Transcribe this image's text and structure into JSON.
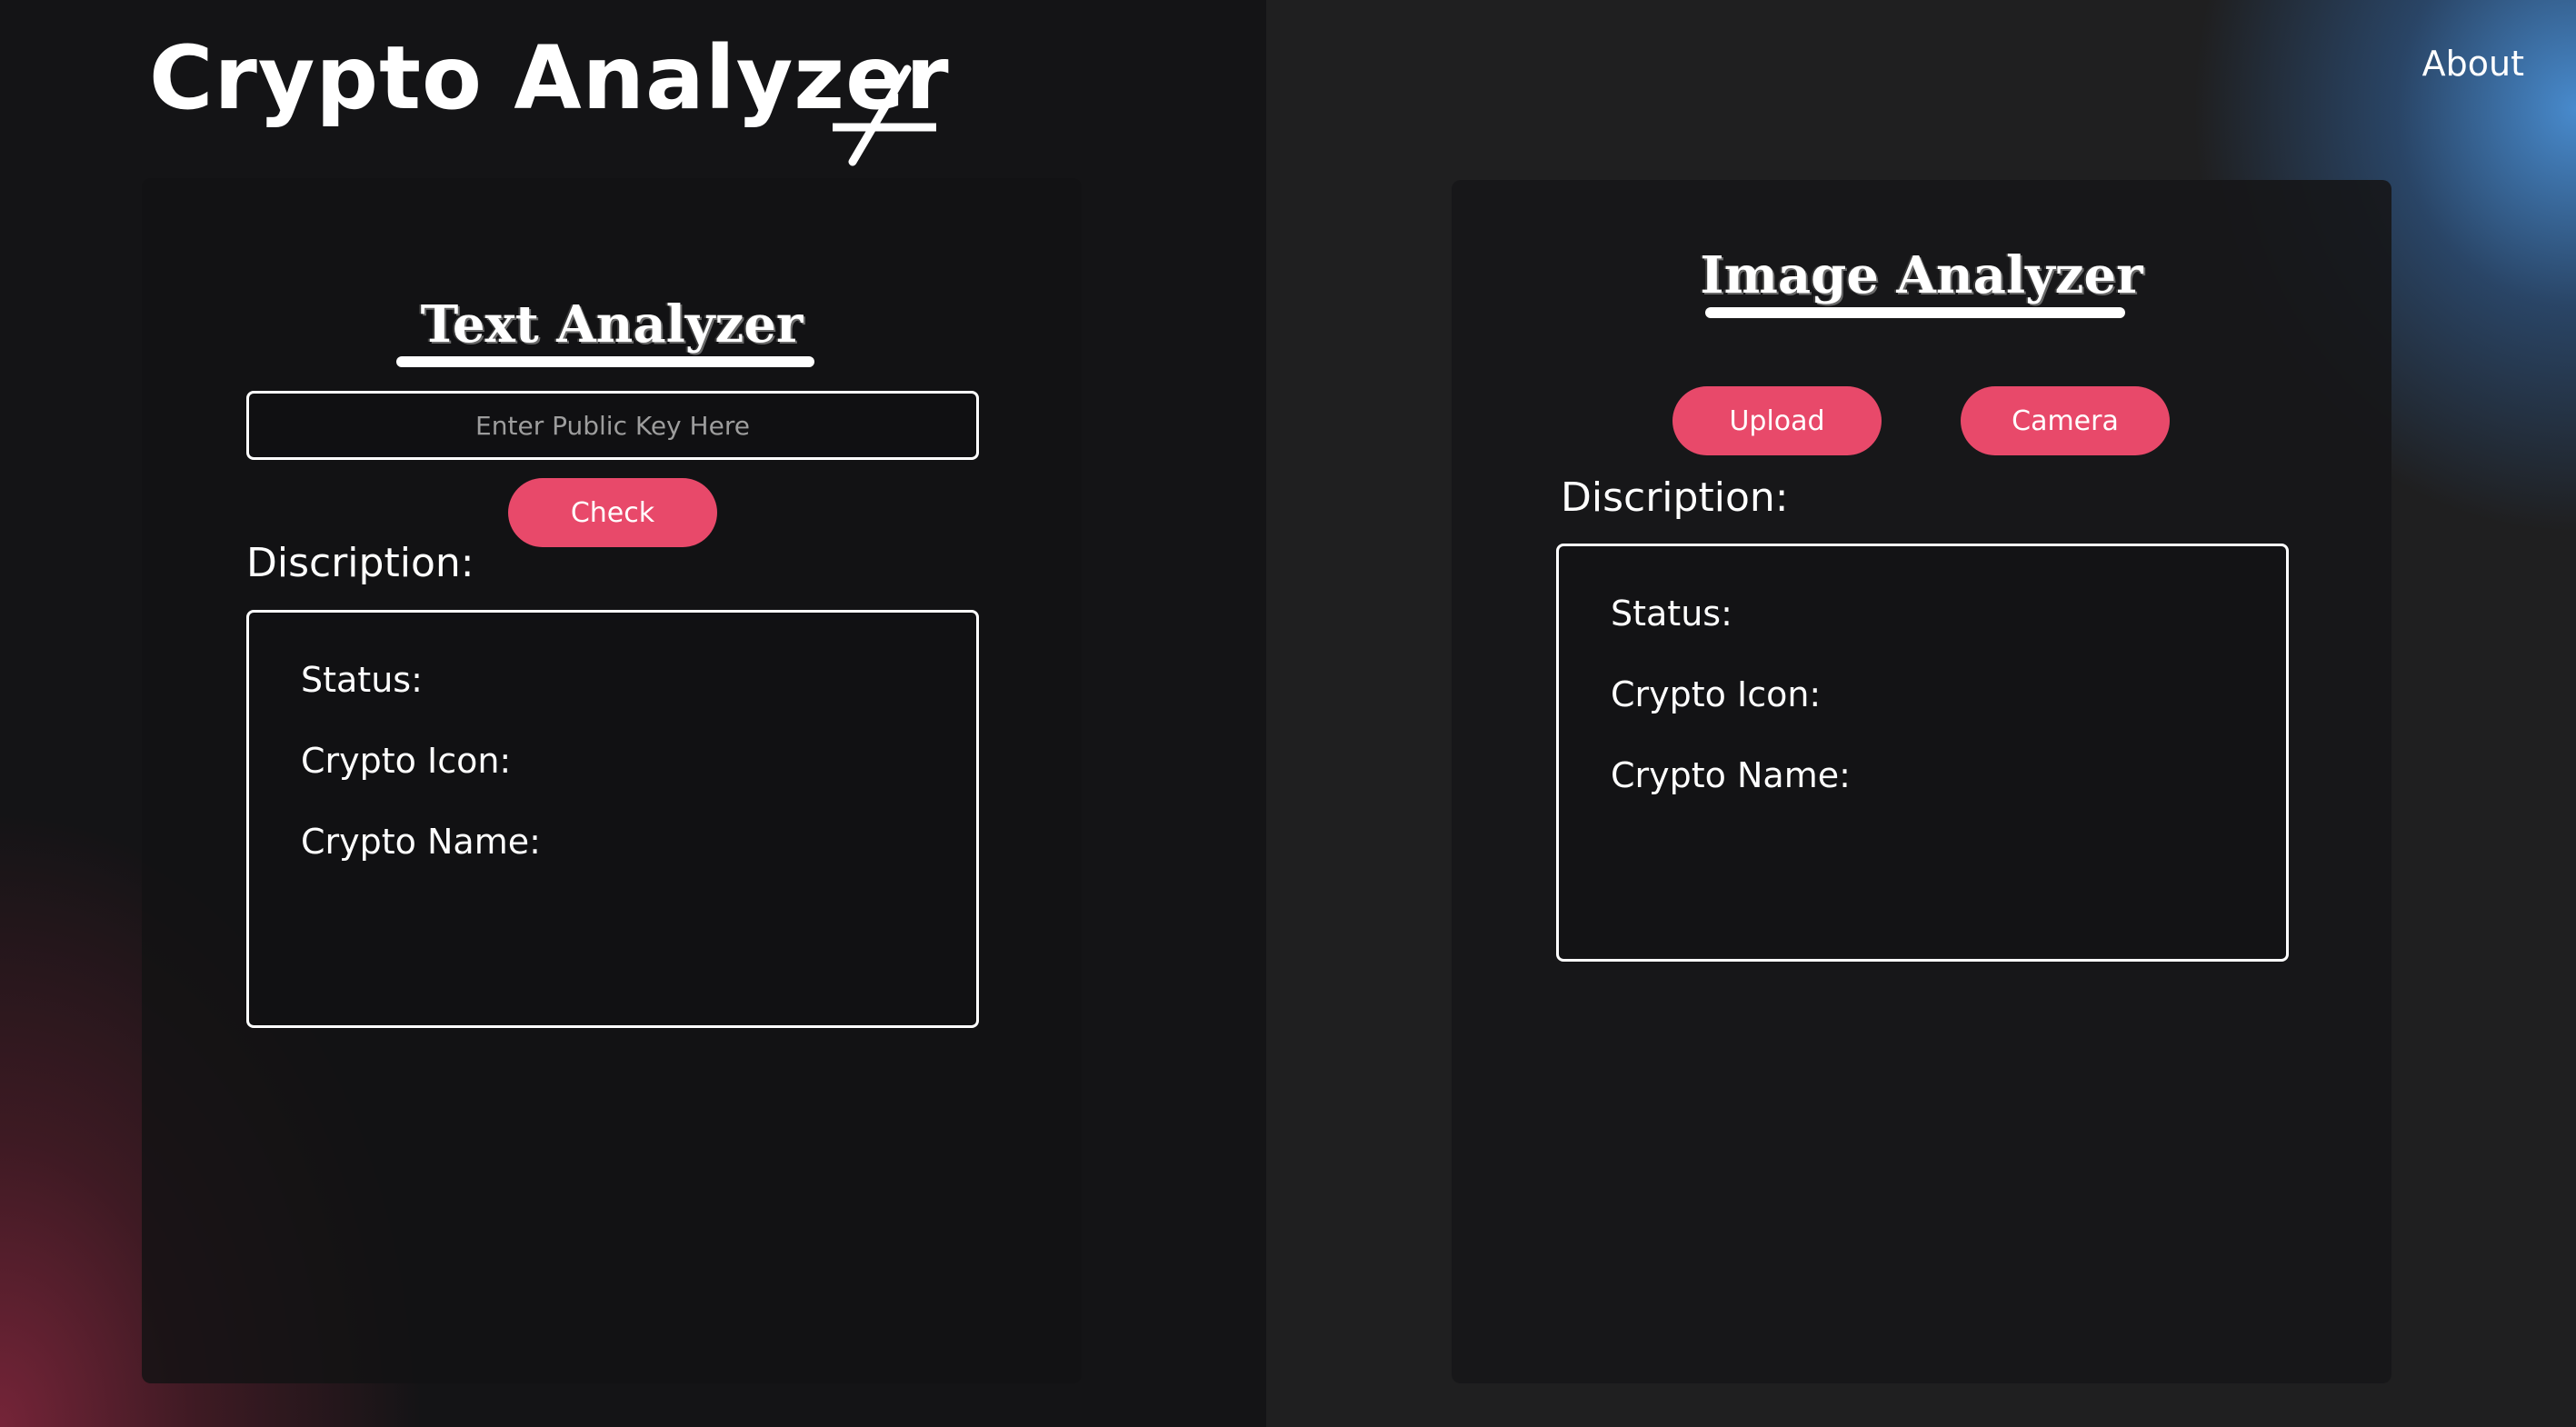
{
  "header": {
    "app_title": "Crypto Analyzer",
    "about_label": "About"
  },
  "text_analyzer": {
    "heading": "Text Analyzer",
    "input_placeholder": "Enter Public Key Here",
    "input_value": "",
    "check_label": "Check",
    "description_label": "Discription:",
    "fields": [
      "Status:",
      "Crypto Icon:",
      "Crypto Name:"
    ]
  },
  "image_analyzer": {
    "heading": "Image Analyzer",
    "upload_label": "Upload",
    "camera_label": "Camera",
    "description_label": "Discription:",
    "fields": [
      "Status:",
      "Crypto Icon:",
      "Crypto Name:"
    ]
  },
  "colors": {
    "accent": "#e8496a",
    "left_glow": "#7a253a",
    "right_glow": "#4a90d6",
    "panel": "#141416",
    "text": "#ffffff"
  },
  "icons": {
    "logo_mark": "slash-cross-icon"
  }
}
